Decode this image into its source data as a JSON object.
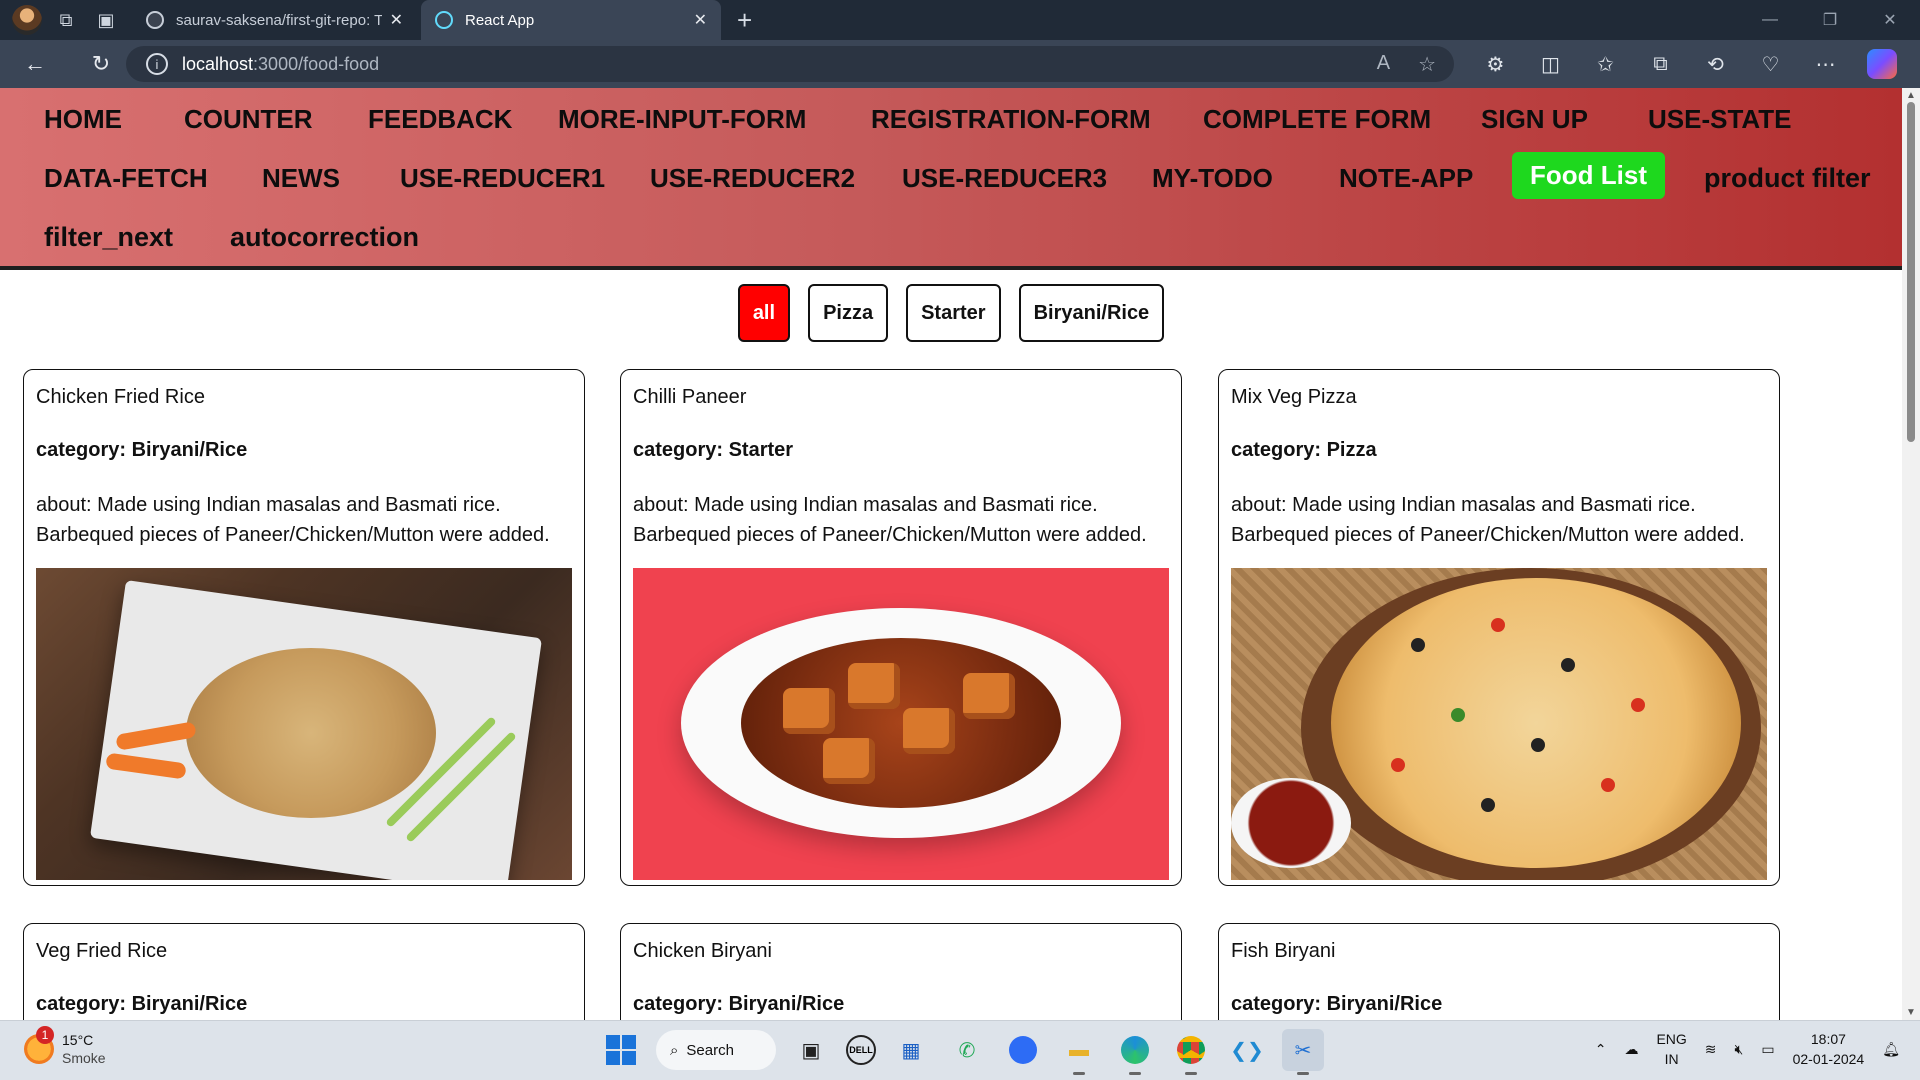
{
  "browser": {
    "tabs": [
      {
        "label": "saurav-saksena/first-git-repo: Th",
        "active": false
      },
      {
        "label": "React App",
        "active": true
      }
    ],
    "url_host": "localhost",
    "url_path": ":3000/food-food"
  },
  "nav": {
    "items": [
      "HOME",
      "COUNTER",
      "FEEDBACK",
      "MORE-INPUT-FORM",
      "REGISTRATION-FORM",
      "COMPLETE FORM",
      "SIGN UP",
      "USE-STATE",
      "DATA-FETCH",
      "NEWS",
      "USE-REDUCER1",
      "USE-REDUCER2",
      "USE-REDUCER3",
      "MY-TODO",
      "NOTE-APP",
      "Food List",
      "product filter",
      "filter_next",
      "autocorrection"
    ],
    "active": "Food List"
  },
  "filters": {
    "buttons": [
      "all",
      "Pizza",
      "Starter",
      "Biryani/Rice"
    ],
    "active": "all"
  },
  "cards": [
    {
      "name": "Chicken Fried Rice",
      "category": "category: Biryani/Rice",
      "about": "about: Made using Indian masalas and Basmati rice. Barbequed pieces of Paneer/Chicken/Mutton were added.",
      "image": "fried-rice-photo"
    },
    {
      "name": "Chilli Paneer",
      "category": "category: Starter",
      "about": "about: Made using Indian masalas and Basmati rice. Barbequed pieces of Paneer/Chicken/Mutton were added.",
      "image": "chilli-paneer-photo"
    },
    {
      "name": "Mix Veg Pizza",
      "category": "category: Pizza",
      "about": "about: Made using Indian masalas and Basmati rice. Barbequed pieces of Paneer/Chicken/Mutton were added.",
      "image": "pizza-photo"
    },
    {
      "name": "Veg Fried Rice",
      "category": "category: Biryani/Rice"
    },
    {
      "name": "Chicken Biryani",
      "category": "category: Biryani/Rice"
    },
    {
      "name": "Fish Biryani",
      "category": "category: Biryani/Rice"
    }
  ],
  "taskbar": {
    "weather_temp": "15°C",
    "weather_desc": "Smoke",
    "weather_badge": "1",
    "search_label": "Search",
    "lang_top": "ENG",
    "lang_bottom": "IN",
    "time": "18:07",
    "date": "02-01-2024"
  },
  "colors": {
    "nav_active": "#1ed81e",
    "filter_active": "#ff0000"
  }
}
